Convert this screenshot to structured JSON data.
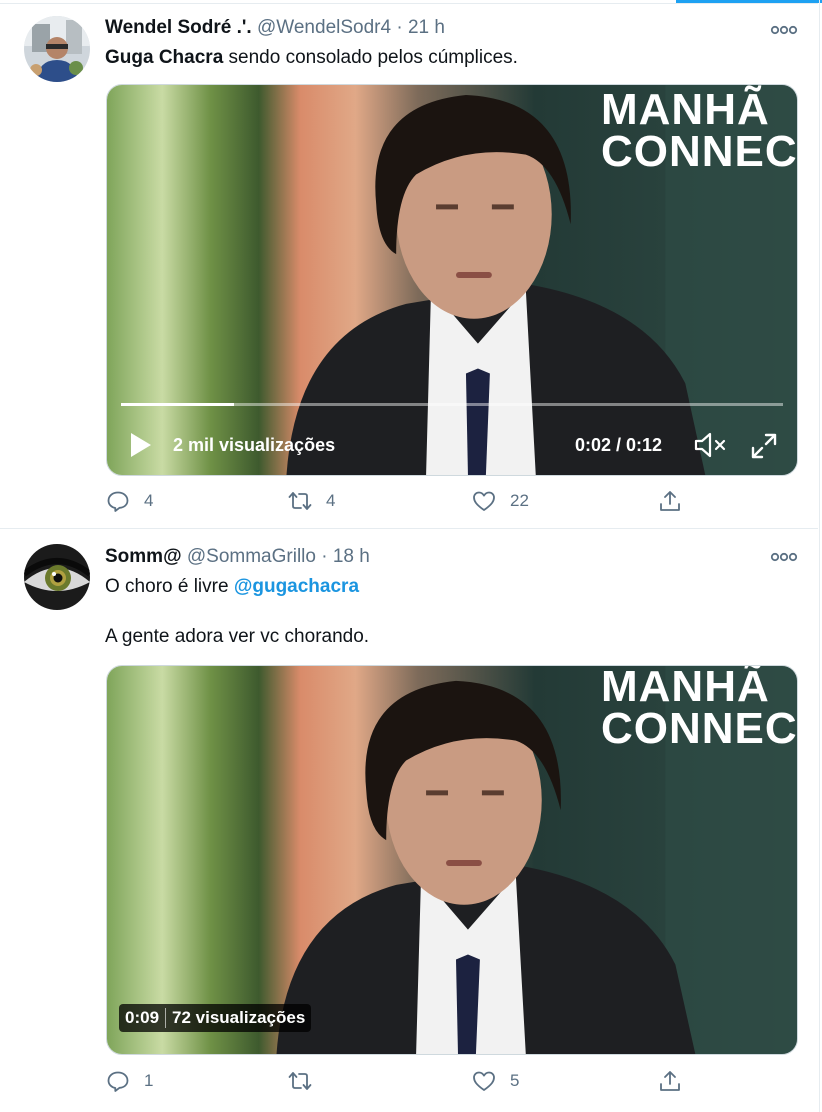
{
  "tweets": [
    {
      "name": "Wendel Sodré .'.",
      "handle": "@WendelSodr4",
      "dot": "·",
      "time": "21 h",
      "text_bold": "Guga Chacra",
      "text_rest": " sendo consolado pelos cúmplices.",
      "video": {
        "overlay_line1": "MANHÃ",
        "overlay_line2": "CONNEC",
        "views": "2 mil visualizações",
        "time": "0:02 / 0:12",
        "progress": 0.17
      },
      "actions": {
        "replies": "4",
        "retweets": "4",
        "likes": "22"
      }
    },
    {
      "name": "Somm@",
      "handle": "@SommaGrillo",
      "dot": "·",
      "time": "18 h",
      "text_plain": "O choro é livre ",
      "text_mention": "@gugachacra",
      "text_line2": "A gente adora ver vc chorando.",
      "video": {
        "overlay_line1": "MANHÃ",
        "overlay_line2": "CONNEC",
        "badge_time": "0:09",
        "badge_views": "72 visualizações"
      },
      "actions": {
        "replies": "1",
        "retweets": "",
        "likes": "5"
      }
    }
  ],
  "colors": {
    "accent": "#1da1f2",
    "mention": "#1b95e0",
    "muted": "#5b7083",
    "divider": "#e6ecf0"
  },
  "icons": [
    "more-icon",
    "play-icon",
    "mute-icon",
    "fullscreen-icon",
    "reply-icon",
    "retweet-icon",
    "like-icon",
    "share-icon"
  ]
}
